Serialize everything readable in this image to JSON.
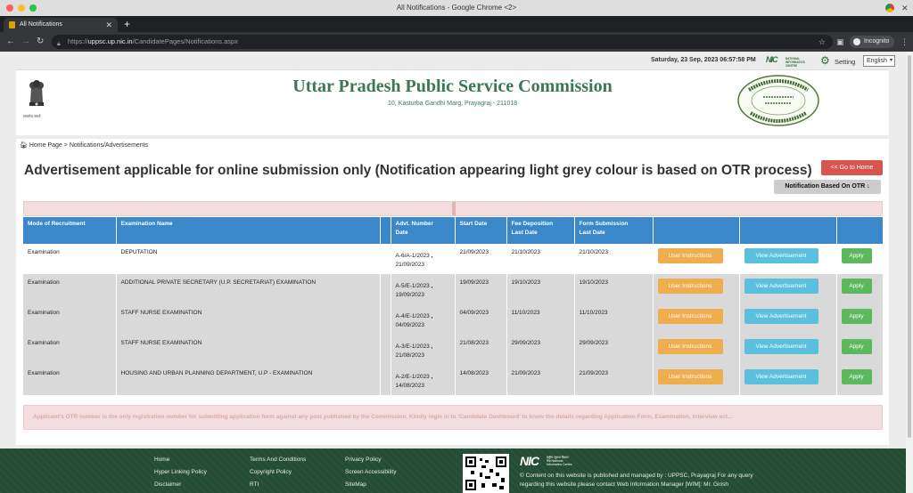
{
  "browser": {
    "window_title": "All Notifications - Google Chrome <2>",
    "tab_title": "All Notifications",
    "url_prefix": "https://",
    "url_host": "uppsc.up.nic.in",
    "url_path": "/CandidatePages/Notifications.aspx",
    "incognito_label": "Incognito"
  },
  "topbar": {
    "datetime": "Saturday, 23 Sep, 2023 06:57:58 PM",
    "nic_label": "NIC",
    "nic_small": "NATIONAL INFORMATICS CENTRE",
    "setting_label": "Setting",
    "language": "English"
  },
  "header": {
    "title": "Uttar Pradesh Public Service Commission",
    "address": "10, Kasturba Gandhi Marg, Prayagraj - 211018",
    "emblem_caption": "सत्यमेव जयते"
  },
  "breadcrumb": {
    "home": "Home Page",
    "separator": ">",
    "current": "Notifications/Advertisements"
  },
  "page": {
    "heading": "Advertisement applicable for online submission only (Notification appearing light grey colour is based on OTR process)",
    "go_home": "<< Go to Home",
    "otr_button": "Notification Based On OTR ↓"
  },
  "table": {
    "headers": {
      "mode": "Mode of Recruitment",
      "exam": "Examination Name",
      "advt_1": "Advt. Number",
      "advt_2": "Date",
      "start": "Start Date",
      "fee_1": "Fee Deposition",
      "fee_2": "Last Date",
      "form_1": "Form Submission",
      "form_2": "Last Date"
    },
    "rows": [
      {
        "mode": "Examination",
        "exam": "DEPUTATION",
        "advt_no": "A-6/A-1/2023",
        "advt_date": "21/09/2023",
        "start": "21/09/2023",
        "fee": "21/10/2023",
        "form": "21/10/2023"
      },
      {
        "mode": "Examination",
        "exam": "ADDITIONAL PRIVATE SECRETARY (U.P. SECRETARIAT) EXAMINATION",
        "advt_no": "A-5/E-1/2023",
        "advt_date": "19/09/2023",
        "start": "19/09/2023",
        "fee": "19/10/2023",
        "form": "19/10/2023"
      },
      {
        "mode": "Examination",
        "exam": "STAFF NURSE EXAMINATION",
        "advt_no": "A-4/E-1/2023",
        "advt_date": "04/09/2023",
        "start": "04/09/2023",
        "fee": "11/10/2023",
        "form": "11/10/2023"
      },
      {
        "mode": "Examination",
        "exam": "STAFF NURSE EXAMINATION",
        "advt_no": "A-3/E-1/2023",
        "advt_date": "21/08/2023",
        "start": "21/08/2023",
        "fee": "29/09/2023",
        "form": "29/09/2023"
      },
      {
        "mode": "Examination",
        "exam": "HOUSING AND URBAN PLANNING DEPARTMENT, U.P - EXAMINATION",
        "advt_no": "A-2/E-1/2023",
        "advt_date": "14/08/2023",
        "start": "14/08/2023",
        "fee": "21/09/2023",
        "form": "21/09/2023"
      }
    ],
    "btn_user_instructions": "User Instructions",
    "btn_view_advertisement": "View Advertisement",
    "btn_apply": "Apply"
  },
  "notice": "Applicant's OTR number is the only registration number for submitting application form against any post published by the Commission. Kindly login in to 'Candidate Dashboard' to know the details regarding Application Form, Examination, Interview ect...",
  "footer": {
    "col1": [
      "Home",
      "Hyper Linking Policy",
      "Disclaimer"
    ],
    "col2": [
      "Terms And Conditions",
      "Copyright Policy",
      "RTI"
    ],
    "col3": [
      "Privacy Policy",
      "Screen Accessibility",
      "SiteMap"
    ],
    "nic_label": "NIC",
    "nic_small": "राष्ट्रीय सूचना विज्ञान केंद्र National Informatics Centre",
    "content_text": "© Content on this website is published and managed by : UPPSC, Prayagraj For any query regarding this website please contact Web Information Manager [WIM]: Mr. Girish"
  },
  "colors": {
    "brand_green": "#3b7755",
    "table_header": "#3a87c9",
    "btn_orange": "#f0ad4e",
    "btn_blue": "#5bc0de",
    "btn_green": "#5cb85c",
    "btn_red": "#d9534f"
  }
}
